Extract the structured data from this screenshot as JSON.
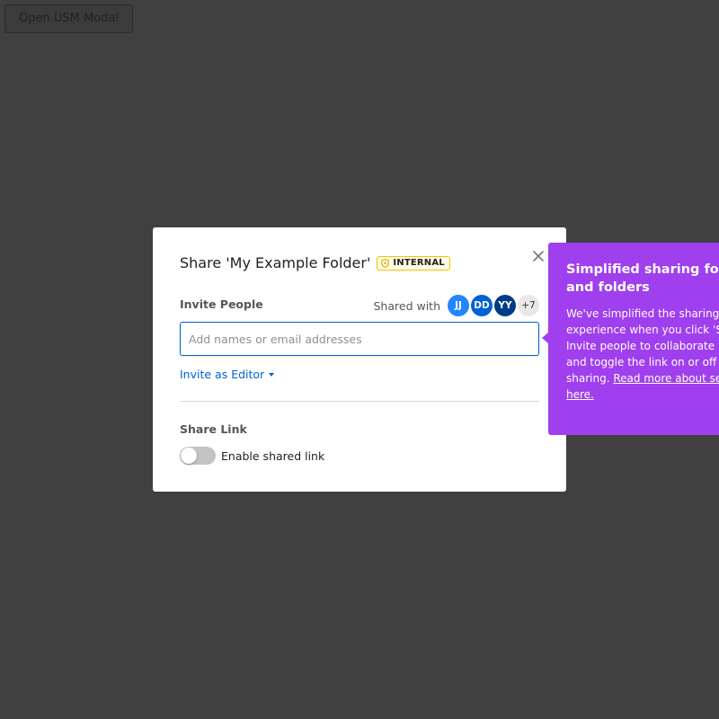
{
  "top_bar": {
    "open_modal_label": "Open USM Modal"
  },
  "modal": {
    "title": "Share 'My Example Folder'",
    "classification": {
      "label": "INTERNAL",
      "color": "#f0c400",
      "icon": "shield-icon"
    },
    "close_icon": "close-icon",
    "invite": {
      "label": "Invite People",
      "shared_with_label": "Shared with",
      "avatars": [
        {
          "initials": "JJ",
          "color": "#2486fc"
        },
        {
          "initials": "DD",
          "color": "#0061d5"
        },
        {
          "initials": "YY",
          "color": "#003c84"
        }
      ],
      "more_count": "+7",
      "input_placeholder": "Add names or email addresses",
      "input_value": "",
      "role_label": "Invite as Editor"
    },
    "share_link": {
      "label": "Share Link",
      "toggle_label": "Enable shared link",
      "enabled": false
    }
  },
  "tooltip": {
    "title": "Simplified sharing for files and folders",
    "body": "We've simplified the sharing experience when you click 'Share'. Invite people to collaborate here and toggle the link on or off for easy sharing.",
    "link_text": "Read more about security here.",
    "background_color": "#9f3fed"
  },
  "colors": {
    "backdrop": "#404040",
    "accent": "#0061d5"
  }
}
